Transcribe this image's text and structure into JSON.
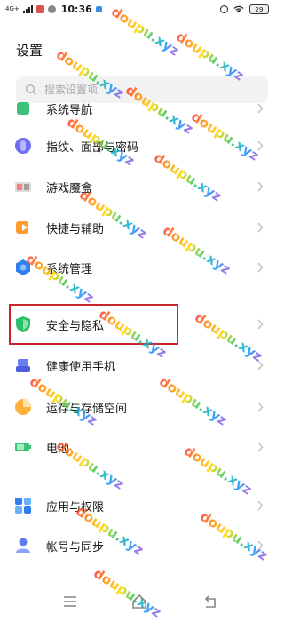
{
  "status_bar": {
    "signal_label": "4G+",
    "time": "10:36",
    "battery": "29"
  },
  "header": {
    "title": "设置"
  },
  "search": {
    "placeholder": "搜索设置项"
  },
  "settings_items": [
    {
      "label": "系统导航",
      "icon": "navigation-icon"
    },
    {
      "label": "指纹、面部与密码",
      "icon": "fingerprint-icon"
    },
    {
      "label": "游戏魔盒",
      "icon": "game-box-icon"
    },
    {
      "label": "快捷与辅助",
      "icon": "shortcut-icon"
    },
    {
      "label": "系统管理",
      "icon": "system-management-icon"
    },
    {
      "label": "安全与隐私",
      "icon": "shield-icon"
    },
    {
      "label": "健康使用手机",
      "icon": "health-icon"
    },
    {
      "label": "运存与存储空间",
      "icon": "storage-icon"
    },
    {
      "label": "电池",
      "icon": "battery-icon"
    },
    {
      "label": "应用与权限",
      "icon": "apps-icon"
    },
    {
      "label": "帐号与同步",
      "icon": "account-icon"
    }
  ],
  "watermark": {
    "text": "doupu.xyz"
  },
  "colors": {
    "highlight_border": "#c9252c",
    "text": "#1a1a1a"
  }
}
